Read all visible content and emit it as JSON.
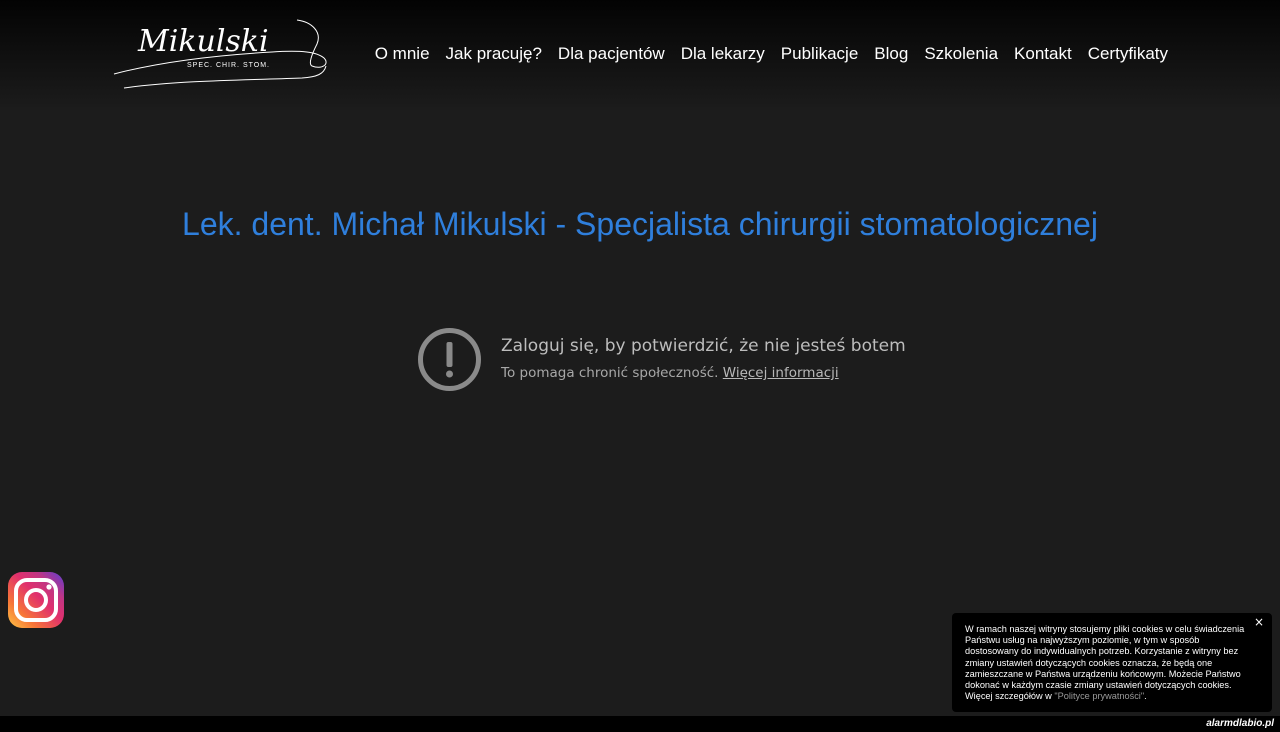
{
  "logo": {
    "script_text": "Mikulski",
    "subtitle": "SPEC. CHIR. STOM."
  },
  "nav": {
    "items": [
      {
        "label": "O mnie"
      },
      {
        "label": "Jak pracuję?"
      },
      {
        "label": "Dla pacjentów"
      },
      {
        "label": "Dla lekarzy"
      },
      {
        "label": "Publikacje"
      },
      {
        "label": "Blog"
      },
      {
        "label": "Szkolenia"
      },
      {
        "label": "Kontakt"
      },
      {
        "label": "Certyfikaty"
      }
    ]
  },
  "main": {
    "headline": "Lek. dent. Michał Mikulski - Specjalista chirurgii stomatologicznej",
    "headline_color": "#2f7fdc"
  },
  "embed_notice": {
    "title": "Zaloguj się, by potwierdzić, że nie jesteś botem",
    "text": "To pomaga chronić społeczność.",
    "link_label": "Więcej informacji",
    "icon": "exclamation-circle-icon"
  },
  "social": {
    "icon": "instagram-icon"
  },
  "cookie_banner": {
    "text_before_link": "W ramach naszej witryny stosujemy pliki cookies w celu świadczenia Państwu usług na najwyższym poziomie, w tym w sposób dostosowany do indywidualnych potrzeb. Korzystanie z witryny bez zmiany ustawień dotyczących cookies oznacza, że będą one zamieszczane w Państwa urządzeniu końcowym. Możecie Państwo dokonać w każdym czasie zmiany ustawień dotyczących cookies. Więcej szczegółów w ",
    "link_label": "\"Polityce prywatności\"",
    "text_after_link": ".",
    "close_label": "×"
  },
  "watermark": {
    "text": "alarmdlabio.pl"
  }
}
